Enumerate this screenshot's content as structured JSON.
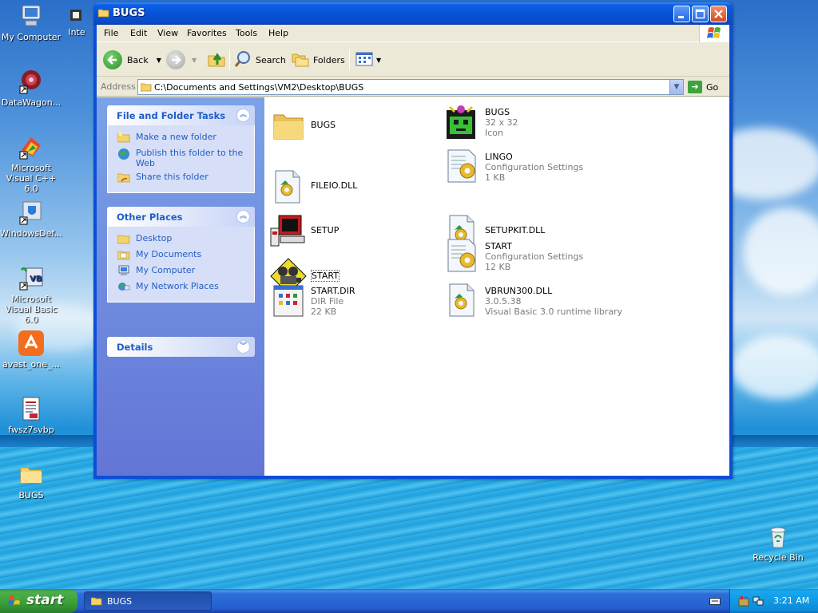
{
  "desktop": {
    "icons": [
      {
        "label": "My Computer"
      },
      {
        "label": "Inte"
      },
      {
        "label": "DataWagon..."
      },
      {
        "label": "Microsoft Visual C++ 6.0"
      },
      {
        "label": "WindowsDef..."
      },
      {
        "label": "Microsoft Visual Basic 6.0"
      },
      {
        "label": "avast_one_..."
      },
      {
        "label": "fwsz7svbp"
      },
      {
        "label": "BUGS"
      },
      {
        "label": "Recycle Bin"
      }
    ]
  },
  "window": {
    "title": "BUGS",
    "menu": [
      "File",
      "Edit",
      "View",
      "Favorites",
      "Tools",
      "Help"
    ],
    "toolbar": {
      "back": "Back",
      "search": "Search",
      "folders": "Folders"
    },
    "address": {
      "label": "Address",
      "value": "C:\\Documents and Settings\\VM2\\Desktop\\BUGS",
      "go": "Go"
    },
    "sidepane": {
      "file_tasks": {
        "title": "File and Folder Tasks",
        "items": [
          "Make a new folder",
          "Publish this folder to the Web",
          "Share this folder"
        ]
      },
      "other_places": {
        "title": "Other Places",
        "items": [
          "Desktop",
          "My Documents",
          "My Computer",
          "My Network Places"
        ]
      },
      "details": {
        "title": "Details"
      }
    },
    "files": [
      {
        "name": "BUGS",
        "line2": "",
        "line3": "",
        "icon": "folder-icon"
      },
      {
        "name": "BUGS",
        "line2": "32 x 32",
        "line3": "Icon",
        "icon": "bug-icon"
      },
      {
        "name": "FILEIO.DLL",
        "line2": "",
        "line3": "",
        "icon": "dll-icon"
      },
      {
        "name": "LINGO",
        "line2": "Configuration Settings",
        "line3": "1 KB",
        "icon": "config-icon"
      },
      {
        "name": "SETUP",
        "line2": "",
        "line3": "",
        "icon": "setup-icon"
      },
      {
        "name": "SETUPKIT.DLL",
        "line2": "",
        "line3": "",
        "icon": "dll-icon"
      },
      {
        "name": "START",
        "line2": "",
        "line3": "",
        "icon": "projector-icon"
      },
      {
        "name": "START",
        "line2": "Configuration Settings",
        "line3": "12 KB",
        "icon": "config-icon"
      },
      {
        "name": "START.DIR",
        "line2": "DIR File",
        "line3": "22 KB",
        "icon": "dir-file-icon"
      },
      {
        "name": "VBRUN300.DLL",
        "line2": "3.0.5.38",
        "line3": "Visual Basic 3.0 runtime library",
        "icon": "dll-icon"
      }
    ]
  },
  "taskbar": {
    "start": "start",
    "task_label": "BUGS",
    "clock": "3:21 AM"
  }
}
